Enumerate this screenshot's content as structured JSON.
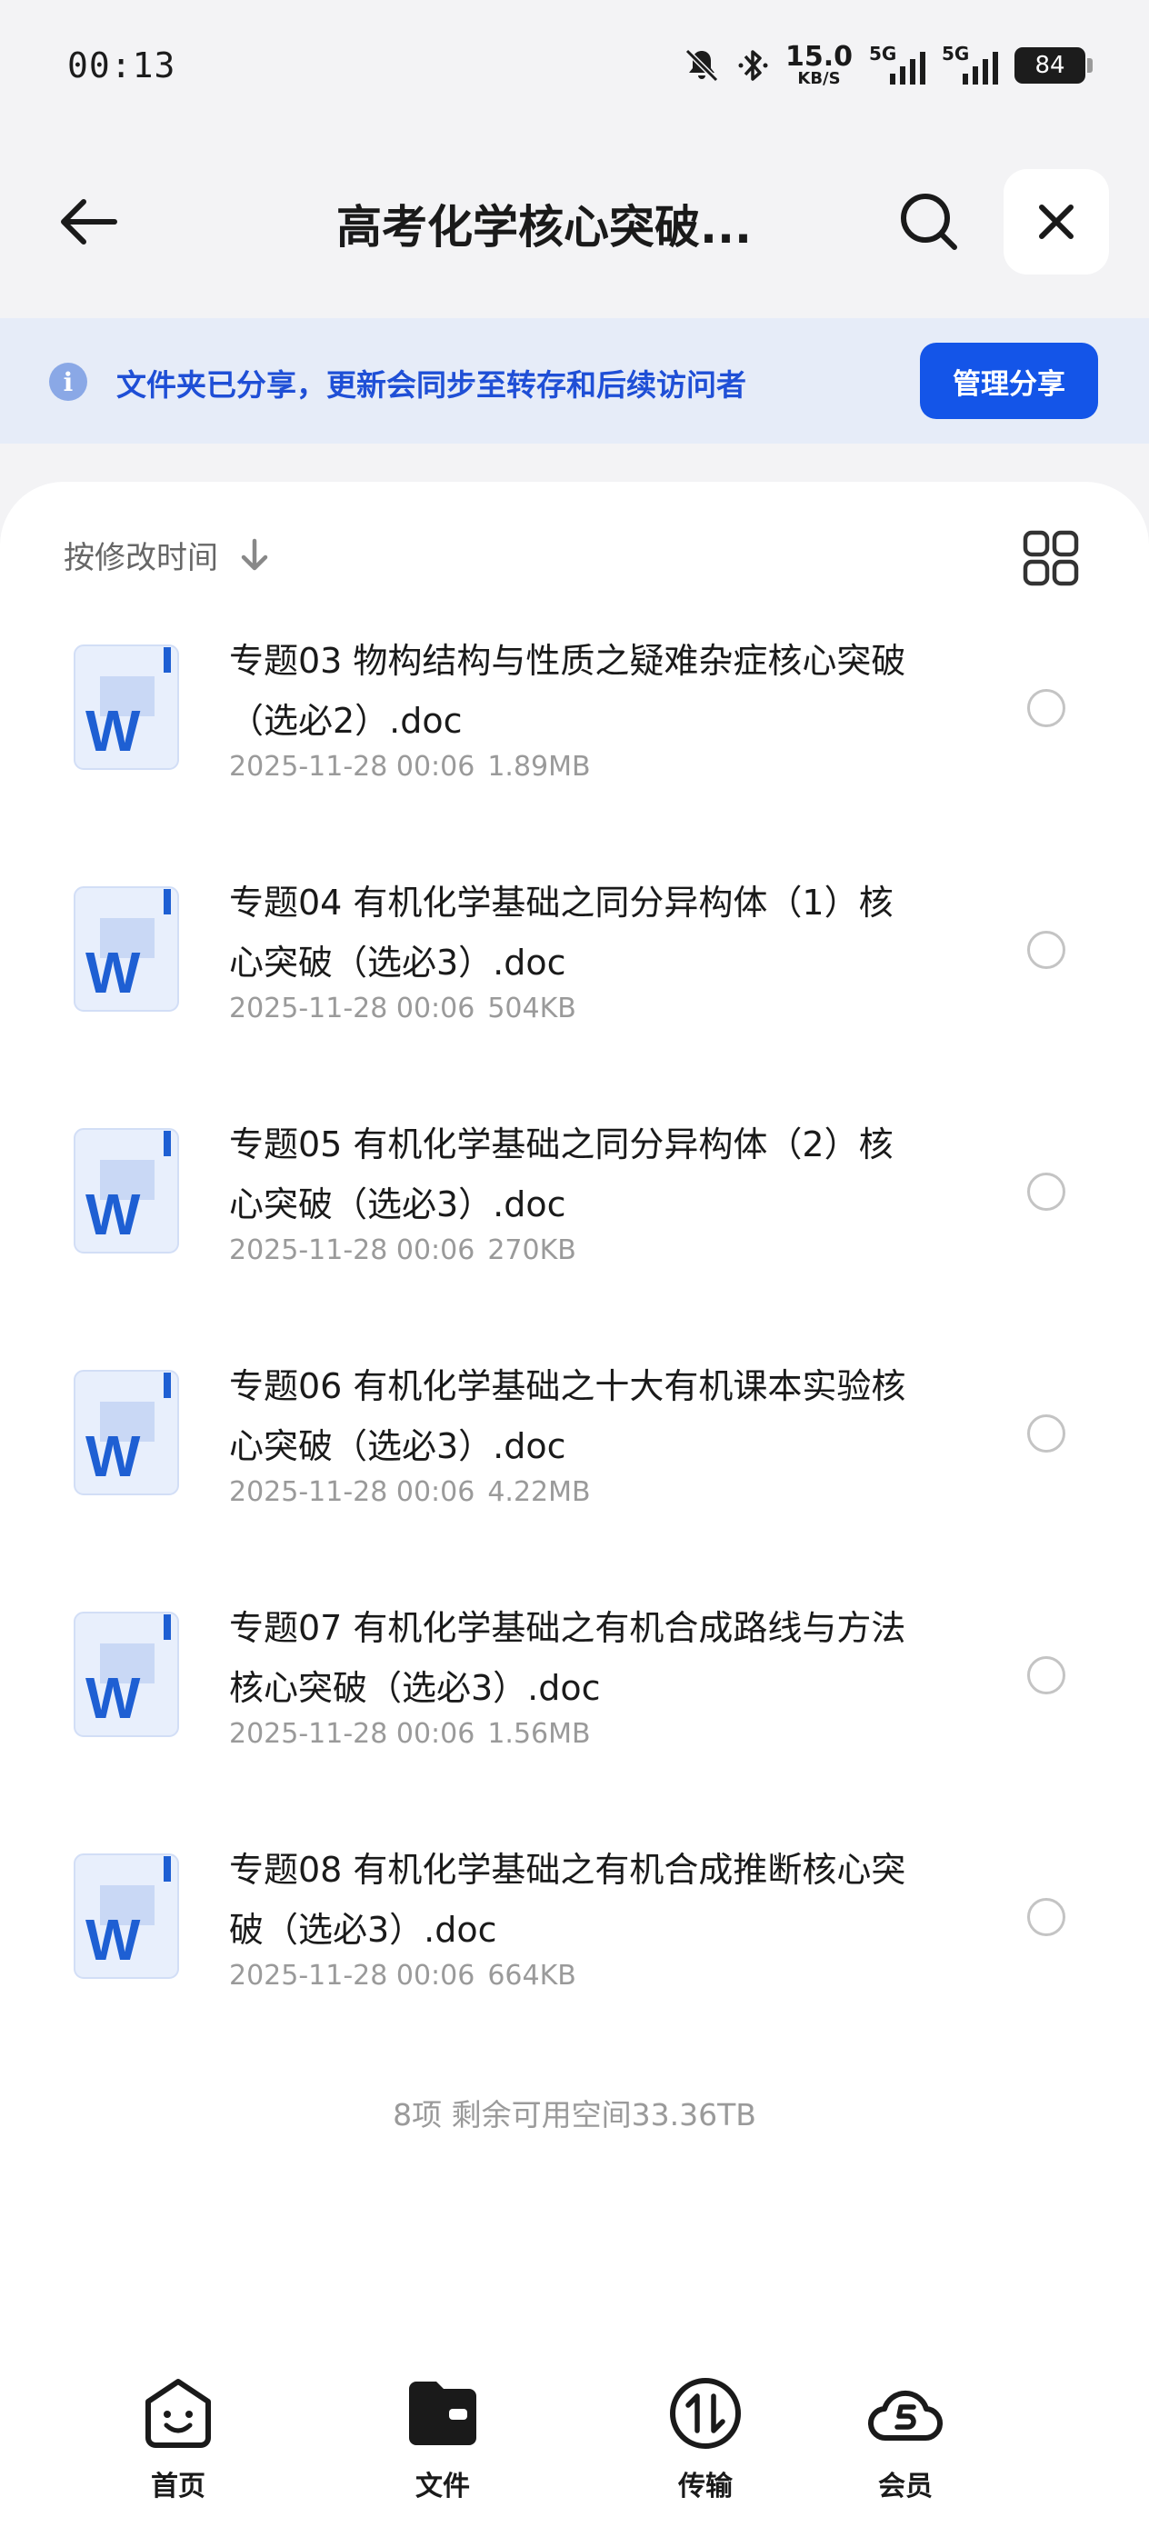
{
  "status_bar": {
    "time": "00:13",
    "speed_value": "15.0",
    "speed_unit": "KB/S",
    "net1": "5G",
    "net2": "5G",
    "battery": "84",
    "icons": [
      "mute-bell-icon",
      "bluetooth-icon",
      "signal-icon",
      "battery-icon"
    ]
  },
  "header": {
    "title": "高考化学核心突破...",
    "icons": [
      "arrow-left-icon",
      "search-icon",
      "close-icon"
    ]
  },
  "share_banner": {
    "text": "文件夹已分享，更新会同步至转存和后续访问者",
    "button": "管理分享",
    "icon": "info-icon"
  },
  "sort": {
    "label": "按修改时间",
    "icon": "arrow-down-icon",
    "view_icon": "grid-view-icon"
  },
  "files": [
    {
      "name": "专题03 物构结构与性质之疑难杂症核心突破（选必2）.doc",
      "date": "2025-11-28 00:06",
      "size": "1.89MB"
    },
    {
      "name": "专题04 有机化学基础之同分异构体（1）核心突破（选必3）.doc",
      "date": "2025-11-28 00:06",
      "size": "504KB"
    },
    {
      "name": "专题05 有机化学基础之同分异构体（2）核心突破（选必3）.doc",
      "date": "2025-11-28 00:06",
      "size": "270KB"
    },
    {
      "name": "专题06 有机化学基础之十大有机课本实验核心突破（选必3）.doc",
      "date": "2025-11-28 00:06",
      "size": "4.22MB"
    },
    {
      "name": "专题07 有机化学基础之有机合成路线与方法核心突破（选必3）.doc",
      "date": "2025-11-28 00:06",
      "size": "1.56MB"
    },
    {
      "name": "专题08 有机化学基础之有机合成推断核心突破（选必3）.doc",
      "date": "2025-11-28 00:06",
      "size": "664KB"
    }
  ],
  "summary": "8项 剩余可用空间33.36TB",
  "colors": {
    "accent": "#1455e8",
    "banner_bg": "#e6ecf8",
    "banner_text": "#1f4fd6",
    "word_blue": "#1e5fd3"
  },
  "bottom_nav": [
    {
      "label": "首页",
      "icon": "home-face-icon"
    },
    {
      "label": "文件",
      "icon": "folder-icon"
    },
    {
      "label": "传输",
      "icon": "transfer-icon"
    },
    {
      "label": "会员",
      "icon": "cloud-s-icon"
    }
  ]
}
